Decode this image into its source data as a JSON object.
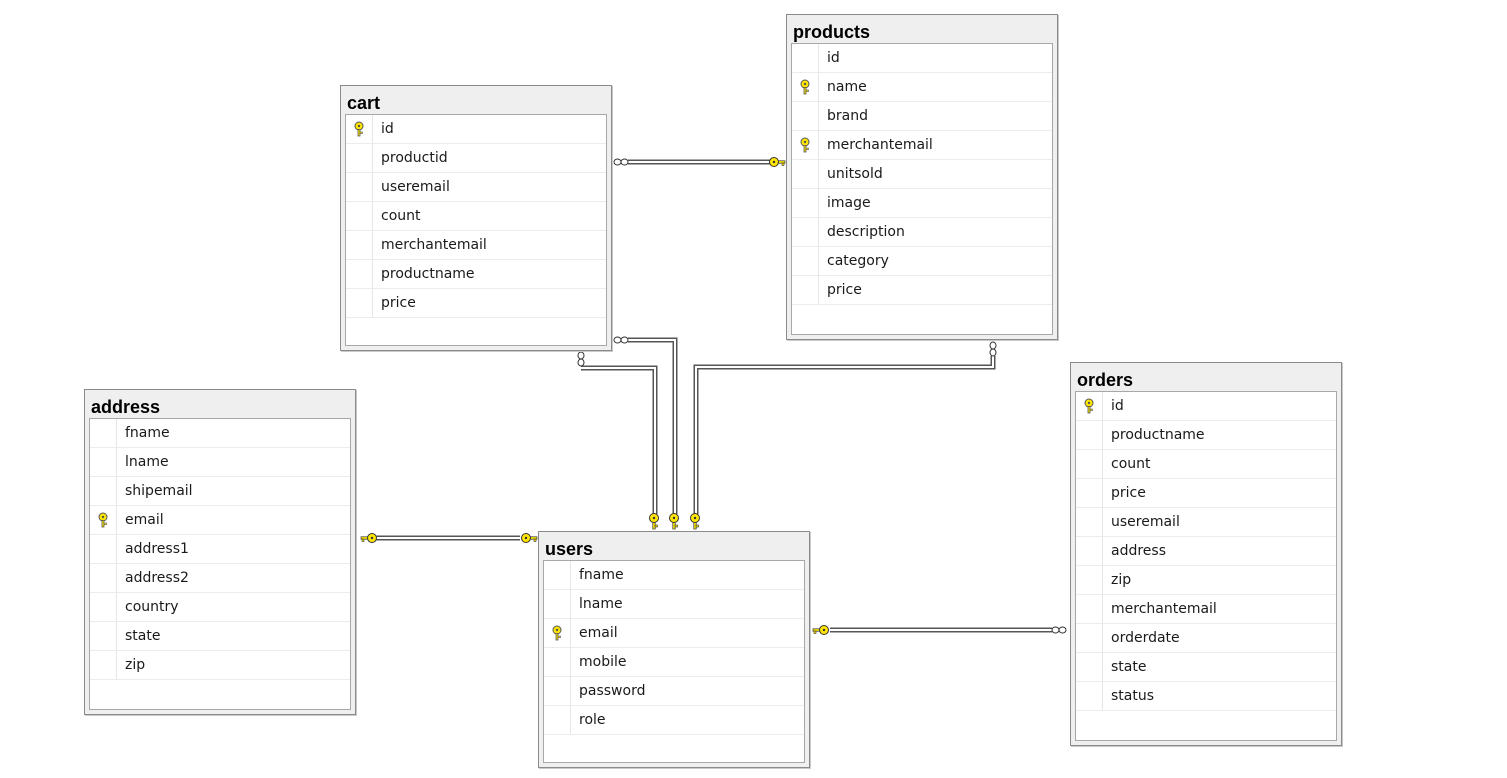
{
  "colors": {
    "key": "#ffe600",
    "key_outline": "#555555",
    "line": "#555555",
    "header_bg": "#efefef"
  },
  "tables": {
    "products": {
      "title": "products",
      "columns": [
        {
          "name": "id",
          "pk": false
        },
        {
          "name": "name",
          "pk": true
        },
        {
          "name": "brand",
          "pk": false
        },
        {
          "name": "merchantemail",
          "pk": true
        },
        {
          "name": "unitsold",
          "pk": false
        },
        {
          "name": "image",
          "pk": false
        },
        {
          "name": "description",
          "pk": false
        },
        {
          "name": "category",
          "pk": false
        },
        {
          "name": "price",
          "pk": false
        }
      ]
    },
    "cart": {
      "title": "cart",
      "columns": [
        {
          "name": "id",
          "pk": true
        },
        {
          "name": "productid",
          "pk": false
        },
        {
          "name": "useremail",
          "pk": false
        },
        {
          "name": "count",
          "pk": false
        },
        {
          "name": "merchantemail",
          "pk": false
        },
        {
          "name": "productname",
          "pk": false
        },
        {
          "name": "price",
          "pk": false
        }
      ]
    },
    "address": {
      "title": "address",
      "columns": [
        {
          "name": "fname",
          "pk": false
        },
        {
          "name": "lname",
          "pk": false
        },
        {
          "name": "shipemail",
          "pk": false
        },
        {
          "name": "email",
          "pk": true
        },
        {
          "name": "address1",
          "pk": false
        },
        {
          "name": "address2",
          "pk": false
        },
        {
          "name": "country",
          "pk": false
        },
        {
          "name": "state",
          "pk": false
        },
        {
          "name": "zip",
          "pk": false
        }
      ]
    },
    "users": {
      "title": "users",
      "columns": [
        {
          "name": "fname",
          "pk": false
        },
        {
          "name": "lname",
          "pk": false
        },
        {
          "name": "email",
          "pk": true
        },
        {
          "name": "mobile",
          "pk": false
        },
        {
          "name": "password",
          "pk": false
        },
        {
          "name": "role",
          "pk": false
        }
      ]
    },
    "orders": {
      "title": "orders",
      "columns": [
        {
          "name": "id",
          "pk": true
        },
        {
          "name": "productname",
          "pk": false
        },
        {
          "name": "count",
          "pk": false
        },
        {
          "name": "price",
          "pk": false
        },
        {
          "name": "useremail",
          "pk": false
        },
        {
          "name": "address",
          "pk": false
        },
        {
          "name": "zip",
          "pk": false
        },
        {
          "name": "merchantemail",
          "pk": false
        },
        {
          "name": "orderdate",
          "pk": false
        },
        {
          "name": "state",
          "pk": false
        },
        {
          "name": "status",
          "pk": false
        }
      ]
    }
  },
  "relationships": [
    {
      "name": "cart-products",
      "one": "products",
      "many": "cart"
    },
    {
      "name": "cart-users-useremail",
      "one": "users",
      "many": "cart"
    },
    {
      "name": "cart-users-merchantemail",
      "one": "users",
      "many": "cart"
    },
    {
      "name": "products-users",
      "one": "users",
      "many": "products"
    },
    {
      "name": "address-users",
      "one": "users",
      "many": "address"
    },
    {
      "name": "orders-users",
      "one": "users",
      "many": "orders"
    }
  ]
}
